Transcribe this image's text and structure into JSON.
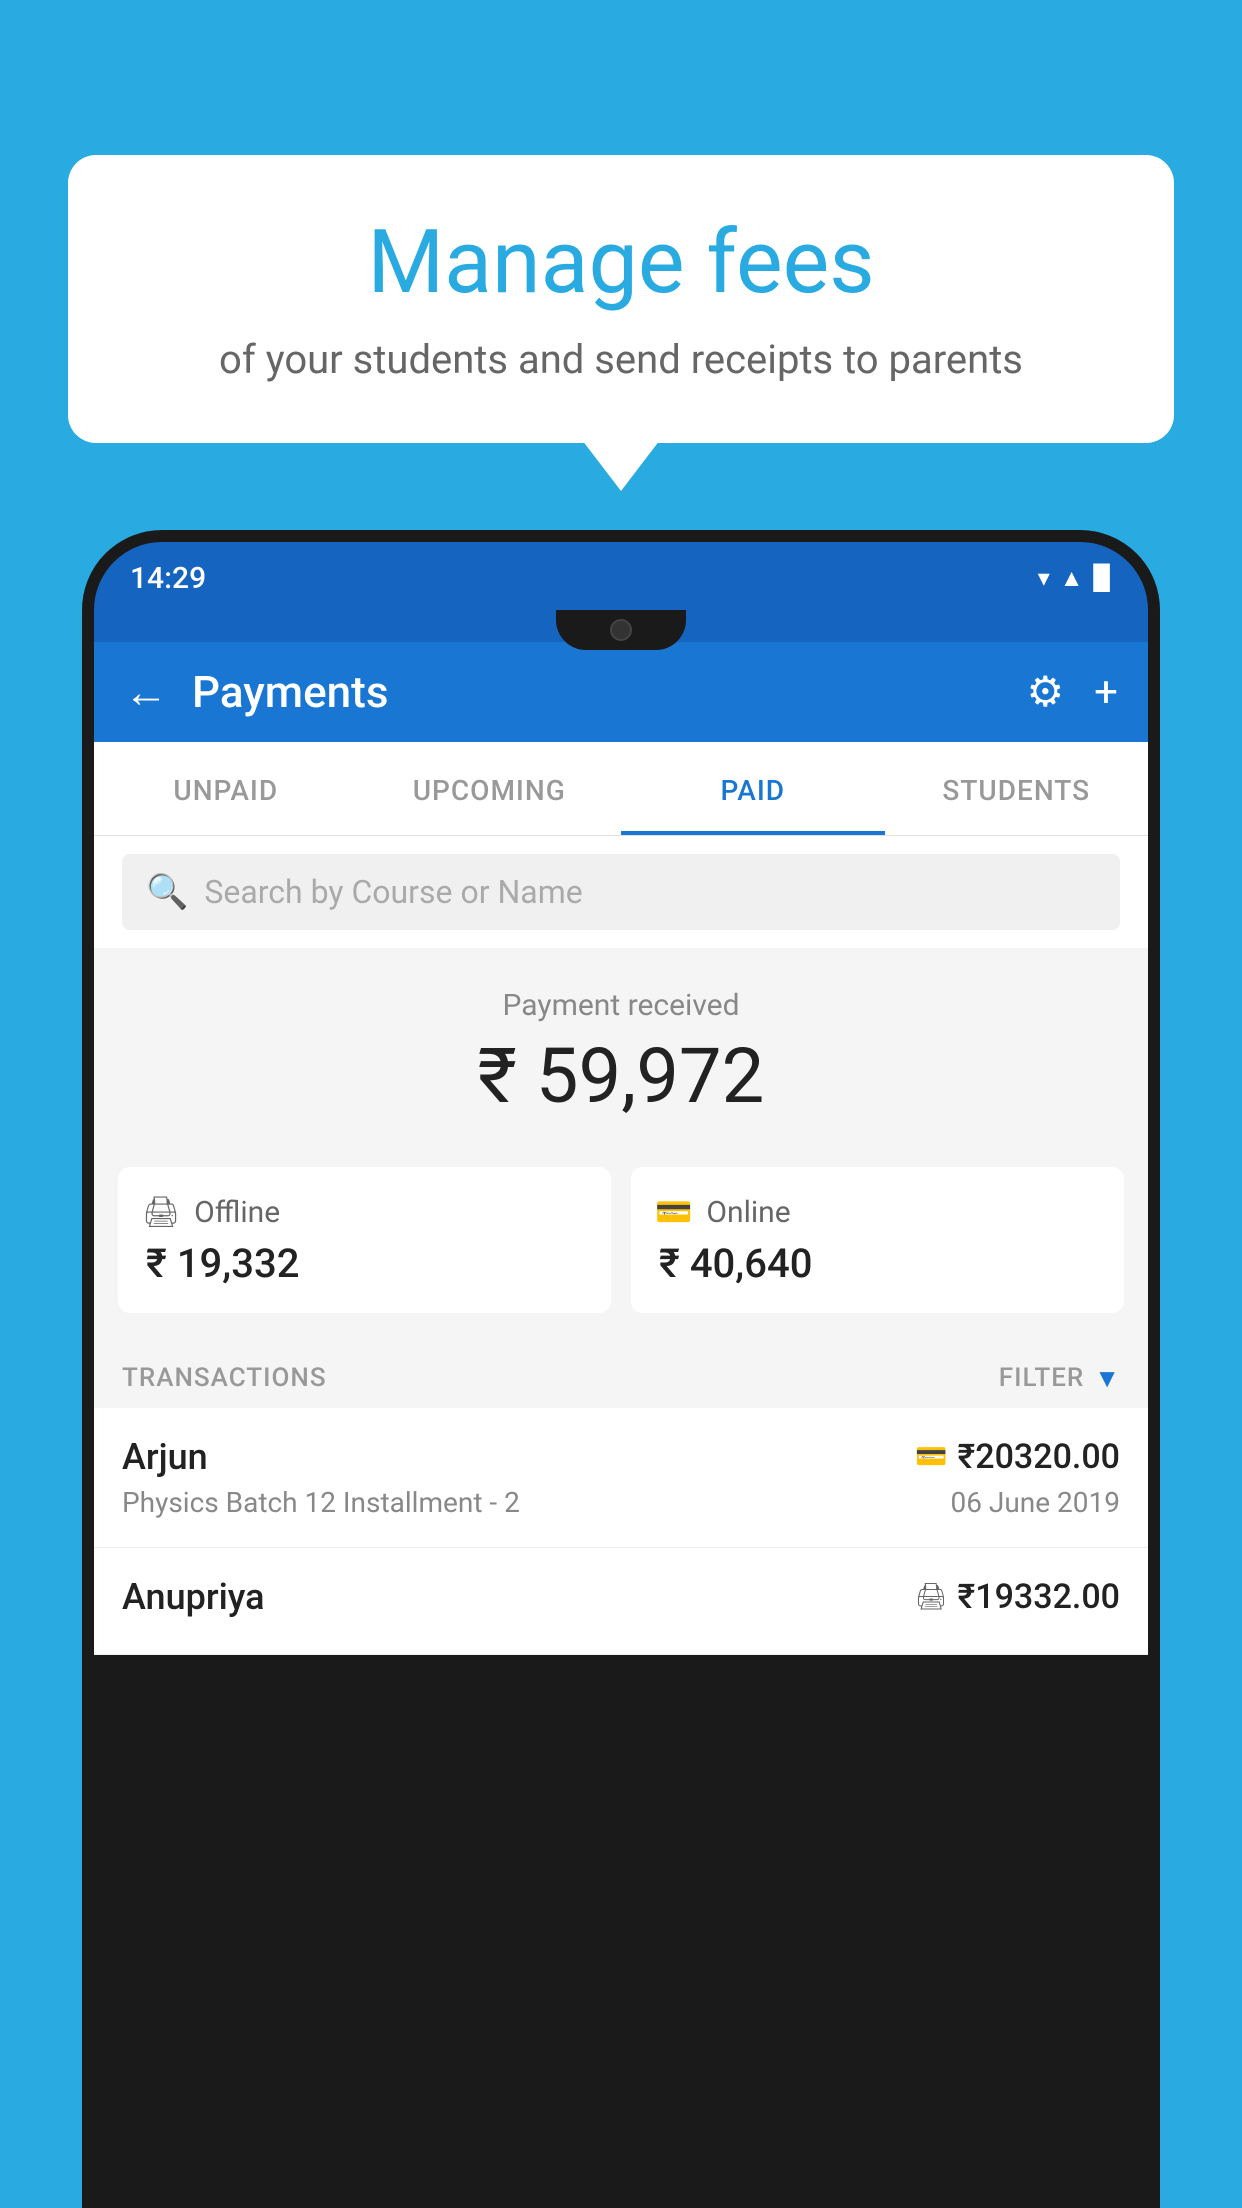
{
  "background_color": "#29ABE2",
  "bubble": {
    "title": "Manage fees",
    "subtitle": "of your students and send receipts to parents"
  },
  "status_bar": {
    "time": "14:29",
    "icons": [
      "wifi",
      "signal",
      "battery"
    ]
  },
  "header": {
    "title": "Payments",
    "back_label": "←",
    "gear_symbol": "⚙",
    "plus_symbol": "+"
  },
  "tabs": [
    {
      "label": "UNPAID",
      "active": false
    },
    {
      "label": "UPCOMING",
      "active": false
    },
    {
      "label": "PAID",
      "active": true
    },
    {
      "label": "STUDENTS",
      "active": false
    }
  ],
  "search": {
    "placeholder": "Search by Course or Name"
  },
  "payment_summary": {
    "label": "Payment received",
    "amount": "₹ 59,972",
    "offline": {
      "label": "Offline",
      "amount": "₹ 19,332"
    },
    "online": {
      "label": "Online",
      "amount": "₹ 40,640"
    }
  },
  "transactions_header": {
    "label": "TRANSACTIONS",
    "filter_label": "FILTER"
  },
  "transactions": [
    {
      "name": "Arjun",
      "course": "Physics Batch 12 Installment - 2",
      "amount": "₹20320.00",
      "date": "06 June 2019",
      "mode": "card"
    },
    {
      "name": "Anupriya",
      "course": "",
      "amount": "₹19332.00",
      "date": "",
      "mode": "offline"
    }
  ]
}
